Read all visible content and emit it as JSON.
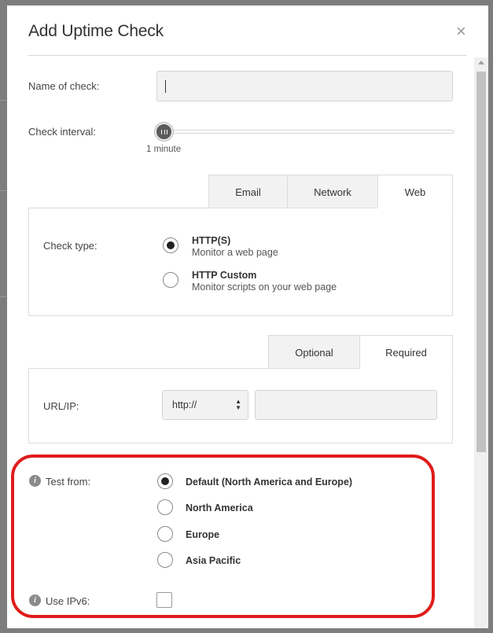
{
  "dialog": {
    "title": "Add Uptime Check",
    "close_icon": "close-icon"
  },
  "form": {
    "name_label": "Name of check:",
    "name_value": "",
    "interval_label": "Check interval:",
    "interval_value": "1 minute",
    "interval_slider_level": 0
  },
  "tabs": [
    {
      "label": "Email",
      "active": false
    },
    {
      "label": "Network",
      "active": false
    },
    {
      "label": "Web",
      "active": true
    }
  ],
  "check_type": {
    "label": "Check type:",
    "options": [
      {
        "title": "HTTP(S)",
        "desc": "Monitor a web page",
        "checked": true
      },
      {
        "title": "HTTP Custom",
        "desc": "Monitor scripts on your web page",
        "checked": false
      }
    ]
  },
  "sub_tabs": [
    {
      "label": "Optional",
      "active": false
    },
    {
      "label": "Required",
      "active": true
    }
  ],
  "url": {
    "label": "URL/IP:",
    "protocol": "http://",
    "value": ""
  },
  "test_from": {
    "label": "Test from:",
    "options": [
      {
        "label": "Default (North America and Europe)",
        "checked": true
      },
      {
        "label": "North America",
        "checked": false
      },
      {
        "label": "Europe",
        "checked": false
      },
      {
        "label": "Asia Pacific",
        "checked": false
      }
    ]
  },
  "ipv6": {
    "label": "Use IPv6:",
    "checked": false
  },
  "colors": {
    "highlight": "#e01b1b",
    "overlay": "#7d7d7d"
  }
}
